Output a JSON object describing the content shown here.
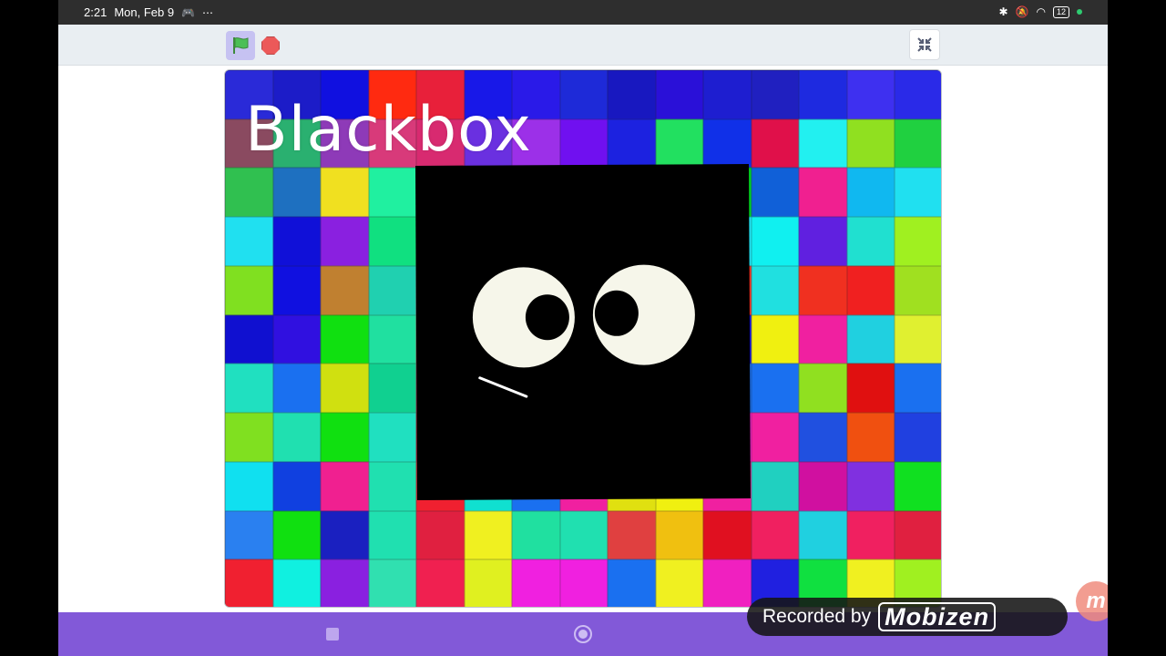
{
  "status_bar": {
    "time": "2:21",
    "date": "Mon, Feb 9",
    "battery": "12"
  },
  "stage": {
    "title": "Blackbox"
  },
  "watermark": {
    "text": "Recorded by",
    "brand": "Mobizen"
  },
  "bubble_letter": "m",
  "colors": {
    "toolbar_bg": "#e9eef2",
    "flag_bg": "#c6c2f2",
    "stop_red": "#ec5959",
    "navbar": "#8259d8",
    "mosaic": [
      [
        "#2a2ad8",
        "#1c1cc8",
        "#1010e0",
        "#ff2a10",
        "#e8203a",
        "#1818e8",
        "#2a1ae8",
        "#1e2ad8",
        "#1818c0",
        "#2a10d8",
        "#1e1ed0",
        "#2020c0",
        "#1e2ae0",
        "#3e30f0",
        "#2a2ae8"
      ],
      [
        "#8a4a60",
        "#2ab070",
        "#8e3ab8",
        "#d83a7a",
        "#d82a70",
        "#6a30e0",
        "#9c30e8",
        "#7010f0",
        "#1c22e0",
        "#22e060",
        "#1030e8",
        "#e0104a",
        "#22f0f0",
        "#90e020",
        "#20d040"
      ],
      [
        "#30c050",
        "#1e70c0",
        "#f0e020",
        "#20f0a0",
        "#f020a0",
        "#30e0e0",
        "#f0f020",
        "#1010d0",
        "#2070f0",
        "#20e0a0",
        "#00d020",
        "#1060d8",
        "#f02090",
        "#10b8f0",
        "#20e0f0"
      ],
      [
        "#20e0f0",
        "#1010d8",
        "#8a20e0",
        "#10e080",
        "#f02040",
        "#20e0f0",
        "#1010d0",
        "#f02090",
        "#2070f0",
        "#a020e0",
        "#20e0f0",
        "#10f0f0",
        "#6020e0",
        "#20e0d0",
        "#a0f020"
      ],
      [
        "#80e020",
        "#1010e0",
        "#c08030",
        "#20d0b0",
        "#f02050",
        "#30e0f0",
        "#20f0f0",
        "#20e0e0",
        "#1010f0",
        "#20d0c0",
        "#f03020",
        "#20e0e0",
        "#f03020",
        "#f02020",
        "#a0e020"
      ],
      [
        "#1010d0",
        "#3010e0",
        "#10e010",
        "#20e0a0",
        "#f02040",
        "#20e0e0",
        "#20d0e0",
        "#10e0e0",
        "#10e0f0",
        "#20e0d0",
        "#1010e0",
        "#f0f010",
        "#f020a0",
        "#20d0e0",
        "#e0f030"
      ],
      [
        "#20e0c0",
        "#1a70f0",
        "#d0e010",
        "#10d090",
        "#f02060",
        "#20f0f0",
        "#f0f020",
        "#2040f0",
        "#10f0f0",
        "#2060f0",
        "#1a70f0",
        "#1a70f0",
        "#90e020",
        "#e01010",
        "#1a70f0"
      ],
      [
        "#80e020",
        "#20e0b0",
        "#10e010",
        "#20e0c0",
        "#e01030",
        "#20e0f0",
        "#10e0f0",
        "#20e0e0",
        "#e0e010",
        "#20d0e0",
        "#f020d0",
        "#f020a0",
        "#2050e0",
        "#f05010",
        "#2040e0"
      ],
      [
        "#10e0f0",
        "#1040e0",
        "#f02090",
        "#20e0b0",
        "#f02030",
        "#10e0d0",
        "#1a70f0",
        "#f020a0",
        "#e0e010",
        "#f0f010",
        "#f020a0",
        "#20d0c0",
        "#d010a0",
        "#8030e0",
        "#10e020"
      ],
      [
        "#2a80f0",
        "#10e010",
        "#1a20c0",
        "#20e0b0",
        "#e02040",
        "#f0f020",
        "#20e0a0",
        "#20e0b0",
        "#e04040",
        "#f0c010",
        "#e01020",
        "#f02060",
        "#20d0e0",
        "#f02060",
        "#e02040"
      ],
      [
        "#f02030",
        "#10f0e0",
        "#8a20e0",
        "#30e0b0",
        "#f02050",
        "#e0f020",
        "#f020e0",
        "#f020e0",
        "#1a70f0",
        "#f0f020",
        "#f020c0",
        "#2020e0",
        "#10e040",
        "#f0f020",
        "#a0f020"
      ]
    ]
  }
}
